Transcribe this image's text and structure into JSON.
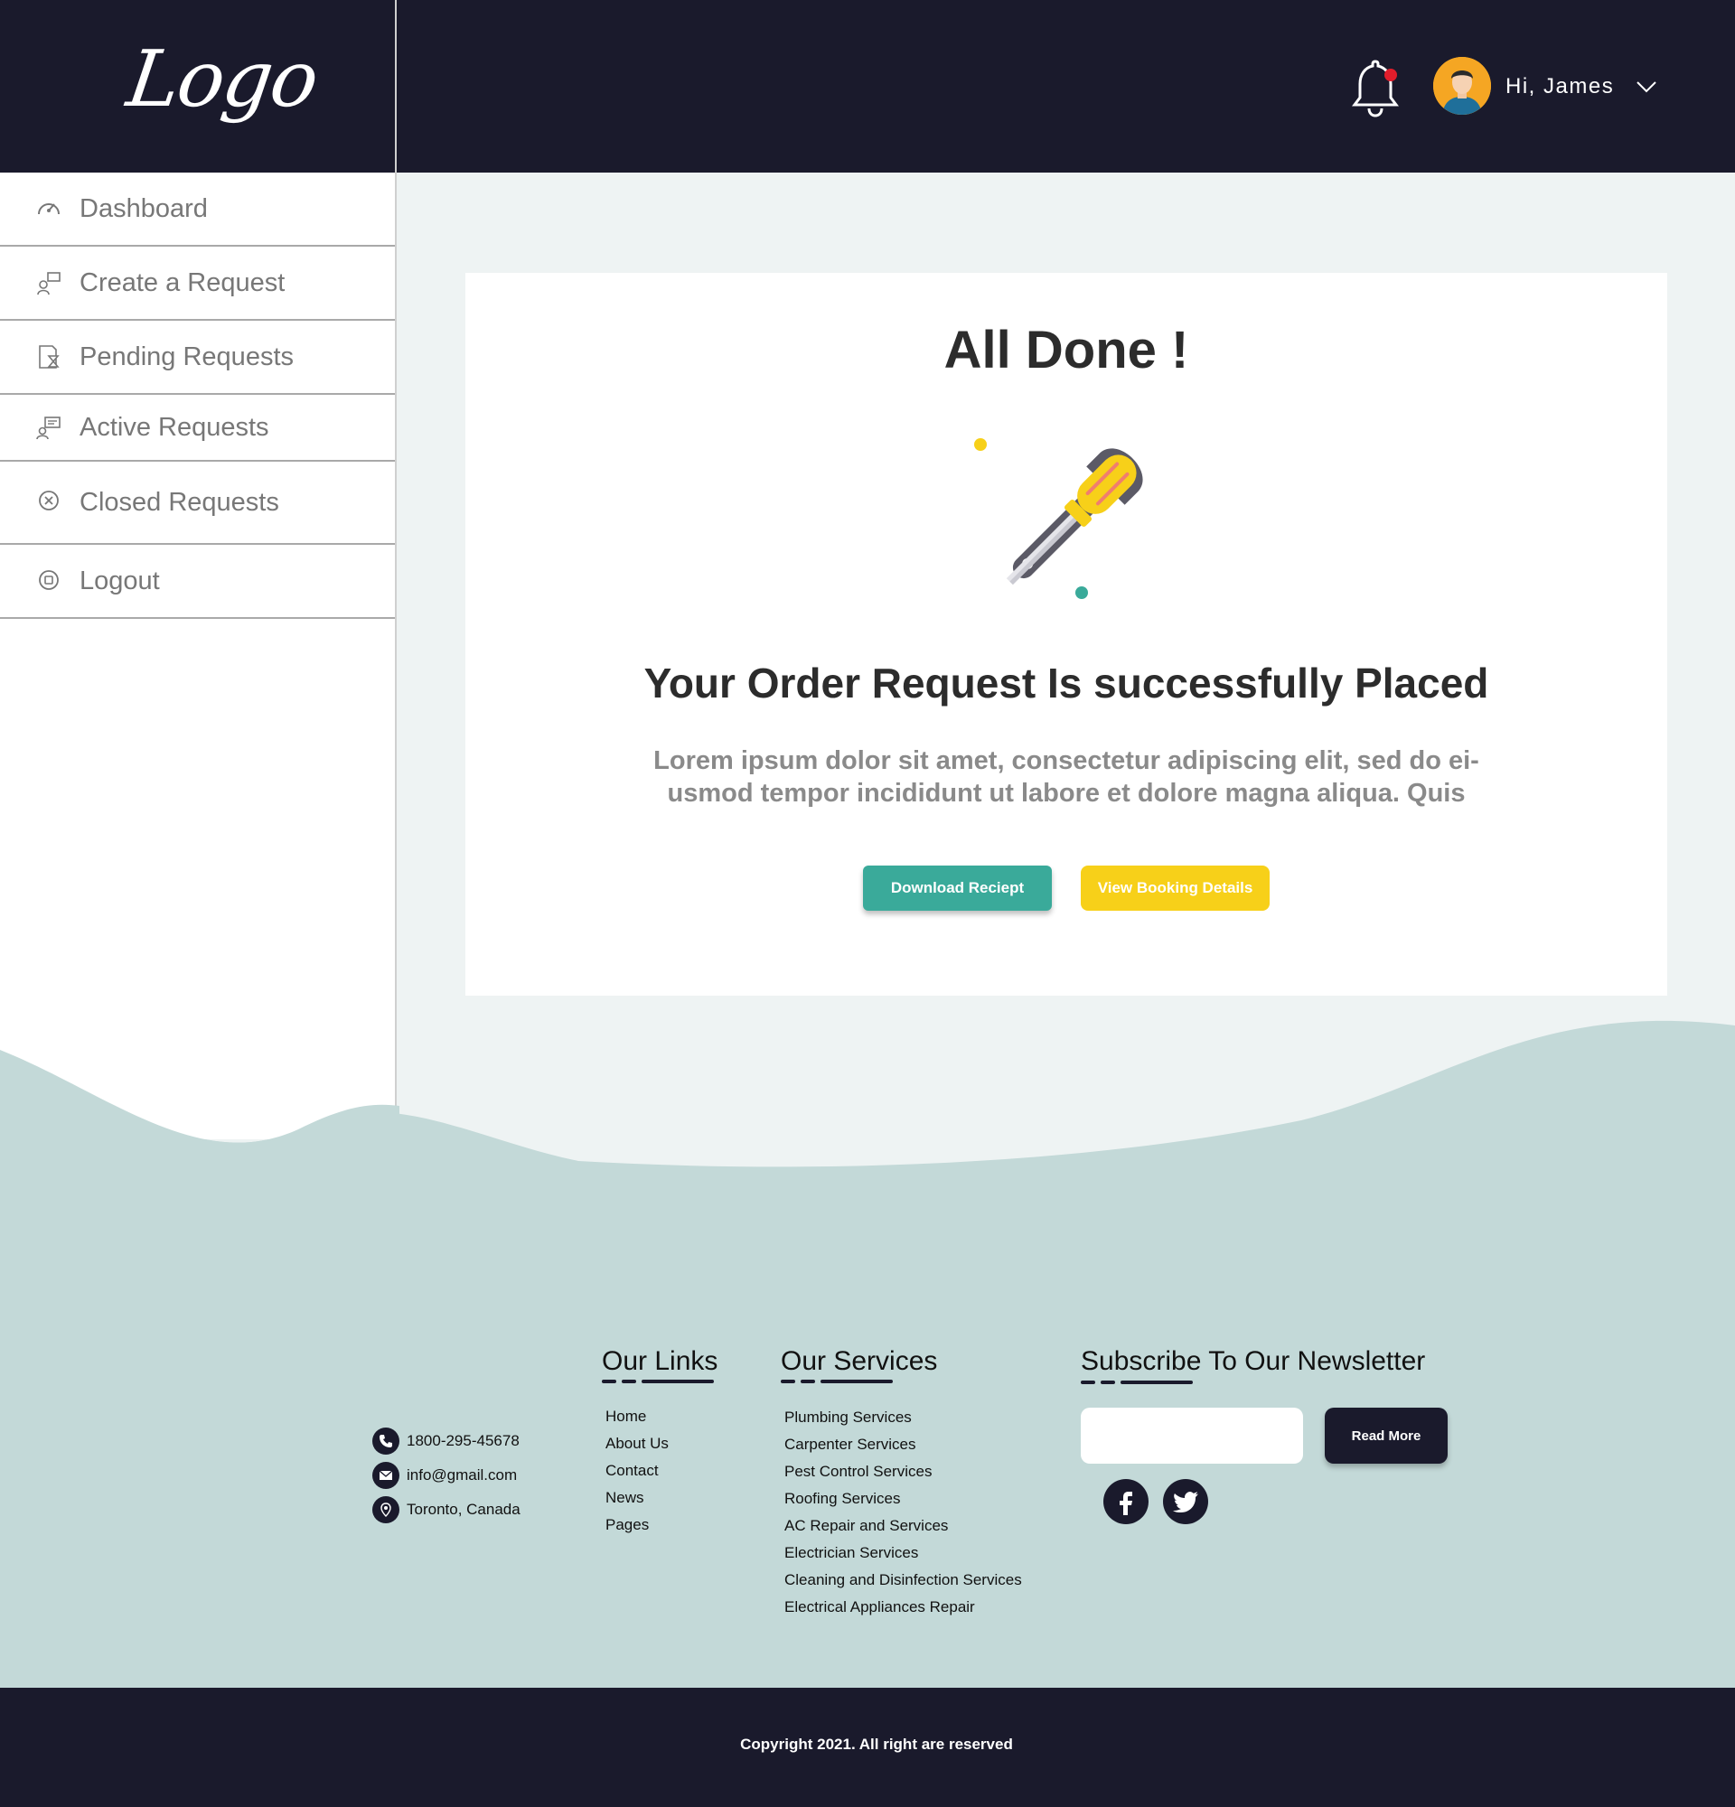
{
  "header": {
    "logo": "Logo",
    "greeting": "Hi, James",
    "colors": {
      "background": "#1a1a2c",
      "notification_dot": "#e11d2b",
      "avatar_bg": "#f5a623"
    }
  },
  "sidebar": {
    "items": [
      {
        "label": "Dashboard",
        "icon": "speedometer-icon"
      },
      {
        "label": "Create a Request",
        "icon": "create-request-icon"
      },
      {
        "label": "Pending Requests",
        "icon": "hourglass-document-icon"
      },
      {
        "label": "Active Requests",
        "icon": "chat-user-icon"
      },
      {
        "label": "Closed Requests",
        "icon": "close-circle-icon"
      },
      {
        "label": "Logout",
        "icon": "logout-icon"
      }
    ]
  },
  "main": {
    "title": "All Done !",
    "icon": "wrench-screwdriver-icon",
    "subtitle": "Your Order Request Is successfully Placed",
    "description": "Lorem ipsum dolor sit amet, consectetur adipiscing elit, sed do ei-usmod tempor incididunt ut labore et dolore magna aliqua. Quis",
    "buttons": {
      "download": "Download Reciept",
      "view": "View Booking Details"
    },
    "colors": {
      "download": "#3aaa9a",
      "view": "#f7d019"
    }
  },
  "footer": {
    "contact": {
      "phone": "1800-295-45678",
      "email": "info@gmail.com",
      "location": "Toronto, Canada"
    },
    "links": {
      "title": "Our Links",
      "items": [
        "Home",
        "About Us",
        "Contact",
        "News",
        "Pages"
      ]
    },
    "services": {
      "title": "Our Services",
      "items": [
        "Plumbing Services",
        "Carpenter Services",
        "Pest Control Services",
        "Roofing Services",
        "AC Repair and Services",
        "Electrician Services",
        "Cleaning and Disinfection Services",
        "Electrical Appliances Repair"
      ]
    },
    "newsletter": {
      "title": "Subscribe To Our Newsletter",
      "input_placeholder": "",
      "button": "Read More"
    },
    "social": [
      "facebook-icon",
      "twitter-icon"
    ],
    "copyright": "Copyright 2021. All right are reserved",
    "colors": {
      "wave": "#c3d9d8",
      "bottom_bar": "#1a1a2c"
    }
  }
}
